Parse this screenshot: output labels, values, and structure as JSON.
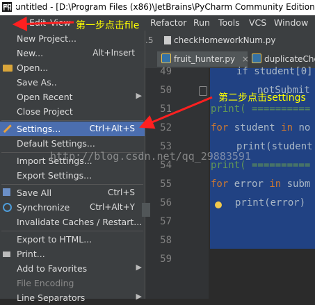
{
  "title_bar": {
    "app_icon": "PC",
    "title": "untitled - [D:\\Program Files (x86)\\JetBrains\\PyCharm Community Edition 20"
  },
  "menubar": {
    "items": [
      "File",
      "Edit",
      "View",
      "Refactor",
      "Run",
      "Tools",
      "VCS",
      "Window"
    ]
  },
  "tabs_top": {
    "prefix": ".5",
    "file": "checkHomeworkNum.py"
  },
  "tabs": [
    {
      "label": "fruit_hunter.py",
      "close": "×"
    },
    {
      "label": "duplicateChe"
    }
  ],
  "file_menu": {
    "items": [
      {
        "label": "New Project..."
      },
      {
        "label": "New...",
        "shortcut": "Alt+Insert"
      },
      {
        "label": "Open...",
        "icon": "folder-icon"
      },
      {
        "label": "Save As.."
      },
      {
        "label": "Open Recent",
        "submenu": true
      },
      {
        "label": "Close Project"
      },
      {
        "label": "Settings...",
        "shortcut": "Ctrl+Alt+S",
        "icon": "wrench-icon",
        "selected": true
      },
      {
        "label": "Default Settings..."
      },
      {
        "label": "Import Settings..."
      },
      {
        "label": "Export Settings..."
      },
      {
        "label": "Save All",
        "shortcut": "Ctrl+S",
        "icon": "save-icon"
      },
      {
        "label": "Synchronize",
        "shortcut": "Ctrl+Alt+Y",
        "icon": "sync-icon"
      },
      {
        "label": "Invalidate Caches / Restart..."
      },
      {
        "label": "Export to HTML..."
      },
      {
        "label": "Print...",
        "icon": "print-icon"
      },
      {
        "label": "Add to Favorites",
        "submenu": true
      },
      {
        "label": "File Encoding",
        "disabled": true
      },
      {
        "label": "Line Separators",
        "submenu": true
      }
    ]
  },
  "editor": {
    "line_numbers": [
      "49",
      "50",
      "51",
      "52",
      "53",
      "54",
      "55",
      "56",
      "57",
      "58",
      "59"
    ],
    "code": [
      "if student[0]",
      "  notSubmit",
      "print( ==========",
      "for student in no",
      "  print(student",
      "print( ==========",
      "for error in subm",
      "  print(error)"
    ]
  },
  "annotations": {
    "step1": "第一步点击file",
    "step2": "第二步点击settings",
    "watermark": "http://blog.csdn.net/qq_29883591",
    "arrow_color": "#ff2020",
    "annotation_color": "#ffff00"
  }
}
